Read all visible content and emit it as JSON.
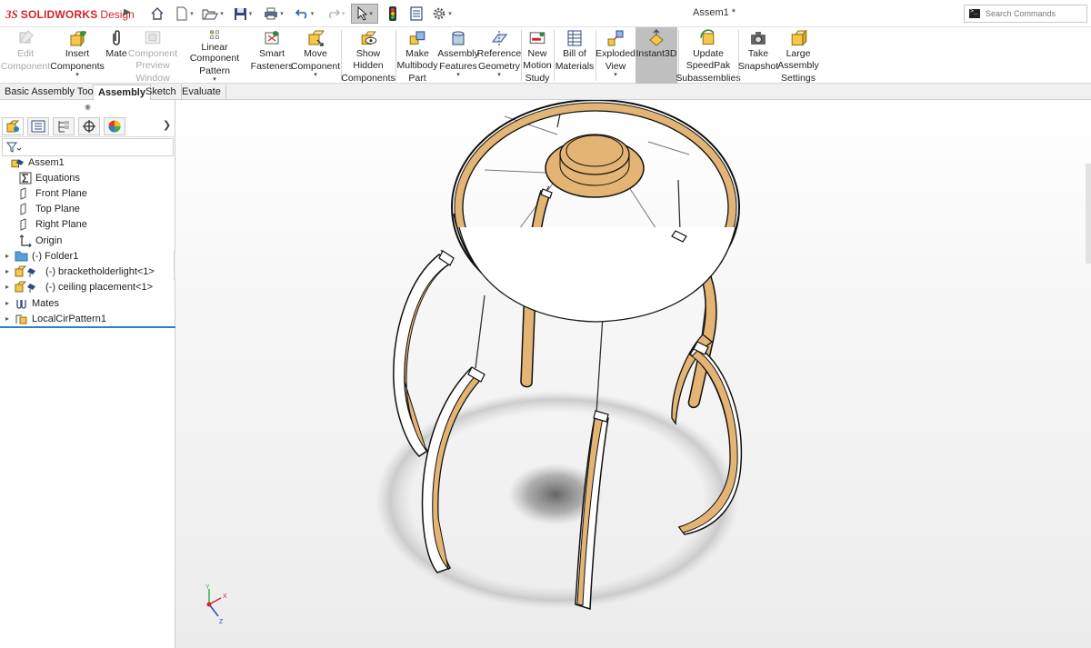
{
  "app": {
    "brand_prefix": "3S",
    "brand_name": "SOLIDWORKS",
    "brand_edition": "Design",
    "document_title": "Assem1 *",
    "search_placeholder": "Search Commands"
  },
  "ribbon": {
    "buttons": [
      {
        "id": "edit-component",
        "line1": "Edit",
        "line2": "Component",
        "line3": "",
        "disabled": true
      },
      {
        "id": "insert-components",
        "line1": "Insert",
        "line2": "Components",
        "line3": "",
        "dropdown": true
      },
      {
        "id": "mate",
        "line1": "Mate",
        "line2": "",
        "line3": ""
      },
      {
        "id": "component-preview-window",
        "line1": "Component",
        "line2": "Preview",
        "line3": "Window",
        "disabled": true
      },
      {
        "id": "linear-component-pattern",
        "line1": "Linear Component",
        "line2": "Pattern",
        "line3": "",
        "dropdown": true
      },
      {
        "id": "smart-fasteners",
        "line1": "Smart",
        "line2": "Fasteners",
        "line3": ""
      },
      {
        "id": "move-component",
        "line1": "Move",
        "line2": "Component",
        "line3": "",
        "dropdown": true
      },
      {
        "id": "show-hidden-components",
        "line1": "Show",
        "line2": "Hidden",
        "line3": "Components"
      },
      {
        "id": "make-multibody-part",
        "line1": "Make",
        "line2": "Multibody",
        "line3": "Part"
      },
      {
        "id": "assembly-features",
        "line1": "Assembly",
        "line2": "Features",
        "line3": "",
        "dropdown": true
      },
      {
        "id": "reference-geometry",
        "line1": "Reference",
        "line2": "Geometry",
        "line3": "",
        "dropdown": true
      },
      {
        "id": "new-motion-study",
        "line1": "New",
        "line2": "Motion",
        "line3": "Study"
      },
      {
        "id": "bill-of-materials",
        "line1": "Bill of",
        "line2": "Materials",
        "line3": ""
      },
      {
        "id": "exploded-view",
        "line1": "Exploded",
        "line2": "View",
        "line3": "",
        "dropdown": true
      },
      {
        "id": "instant3d",
        "line1": "Instant3D",
        "line2": "",
        "line3": "",
        "active": true
      },
      {
        "id": "update-speedpak",
        "line1": "Update",
        "line2": "SpeedPak",
        "line3": "Subassemblies"
      },
      {
        "id": "take-snapshot",
        "line1": "Take",
        "line2": "Snapshot",
        "line3": ""
      },
      {
        "id": "large-assembly-settings",
        "line1": "Large",
        "line2": "Assembly",
        "line3": "Settings"
      }
    ],
    "dropdown_glyph": "▾"
  },
  "tabs": [
    {
      "label": "Basic Assembly Tools",
      "active": false
    },
    {
      "label": "Assembly",
      "active": true
    },
    {
      "label": "Sketch",
      "active": false
    },
    {
      "label": "Evaluate",
      "active": false
    }
  ],
  "tree": {
    "items": [
      {
        "label": "Assem1",
        "icon": "assembly-icon",
        "expander": ""
      },
      {
        "label": "Equations",
        "icon": "equations-icon",
        "expander": ""
      },
      {
        "label": "Front Plane",
        "icon": "plane-icon",
        "expander": ""
      },
      {
        "label": "Top Plane",
        "icon": "plane-icon",
        "expander": ""
      },
      {
        "label": "Right Plane",
        "icon": "plane-icon",
        "expander": ""
      },
      {
        "label": "Origin",
        "icon": "origin-icon",
        "expander": ""
      },
      {
        "label": "(-) Folder1",
        "icon": "folder-icon",
        "expander": "▸"
      },
      {
        "label": "(-) bracketholderlight<1>",
        "icon": "subassembly-icon",
        "expander": "▸"
      },
      {
        "label": "(-) ceiling placement<1>",
        "icon": "subassembly-icon",
        "expander": "▸"
      },
      {
        "label": "Mates",
        "icon": "mates-icon",
        "expander": "▸"
      },
      {
        "label": "LocalCirPattern1",
        "icon": "pattern-icon",
        "expander": "▸"
      }
    ]
  },
  "triad": {
    "x": "X",
    "y": "Y",
    "z": "Z"
  },
  "colors": {
    "brand_red": "#d2232a",
    "wood": "#e3b474",
    "wood_dark": "#b27a3a",
    "active_button": "#bfbfbf",
    "tree_rule": "#2f7fc1"
  }
}
